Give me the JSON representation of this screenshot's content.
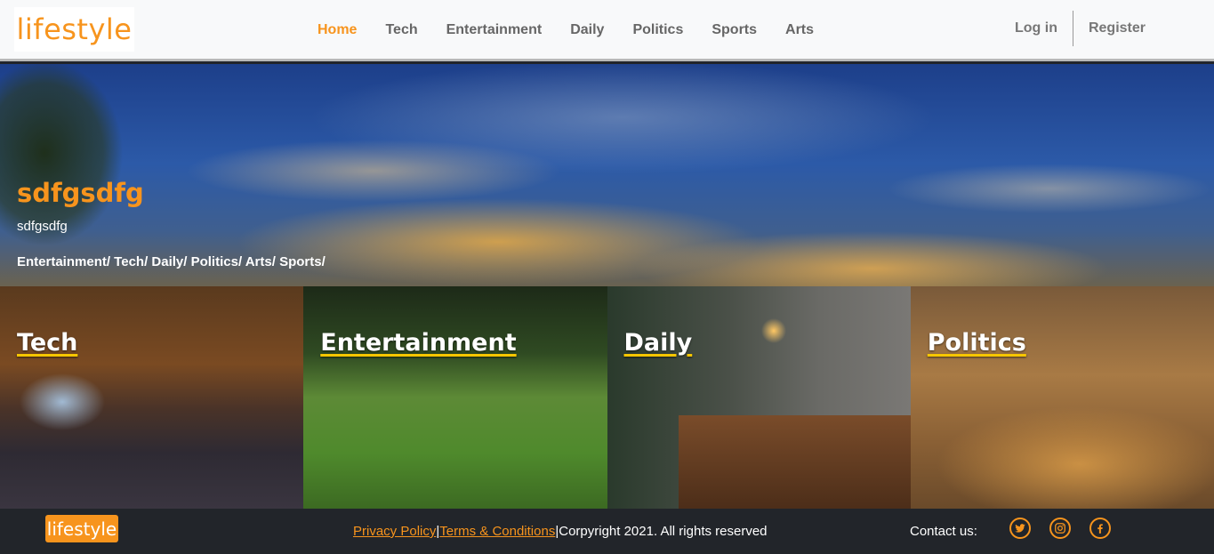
{
  "header": {
    "logo": "lifestyle",
    "nav": [
      "Home",
      "Tech",
      "Entertainment",
      "Daily",
      "Politics",
      "Sports",
      "Arts"
    ],
    "login": "Log in",
    "register": "Register"
  },
  "hero": {
    "title": "sdfgsdfg",
    "subtitle": "sdfgsdfg",
    "categories": "Entertainment/ Tech/ Daily/ Politics/ Arts/ Sports/"
  },
  "tiles": [
    "Tech",
    "Entertainment",
    "Daily",
    "Politics"
  ],
  "footer": {
    "logo": "lifestyle",
    "privacy": "Privacy Policy",
    "sep1": "|",
    "terms": "Terms & Conditions",
    "sep2": "|",
    "copyright": "Corpyright 2021. All rights reserved",
    "contact": "Contact us:",
    "socials": [
      "twitter-icon",
      "instagram-icon",
      "facebook-icon"
    ]
  },
  "colors": {
    "accent": "#f7941d",
    "nav_text": "#666666",
    "footer_bg": "#22252a",
    "underline": "#f7c600"
  }
}
